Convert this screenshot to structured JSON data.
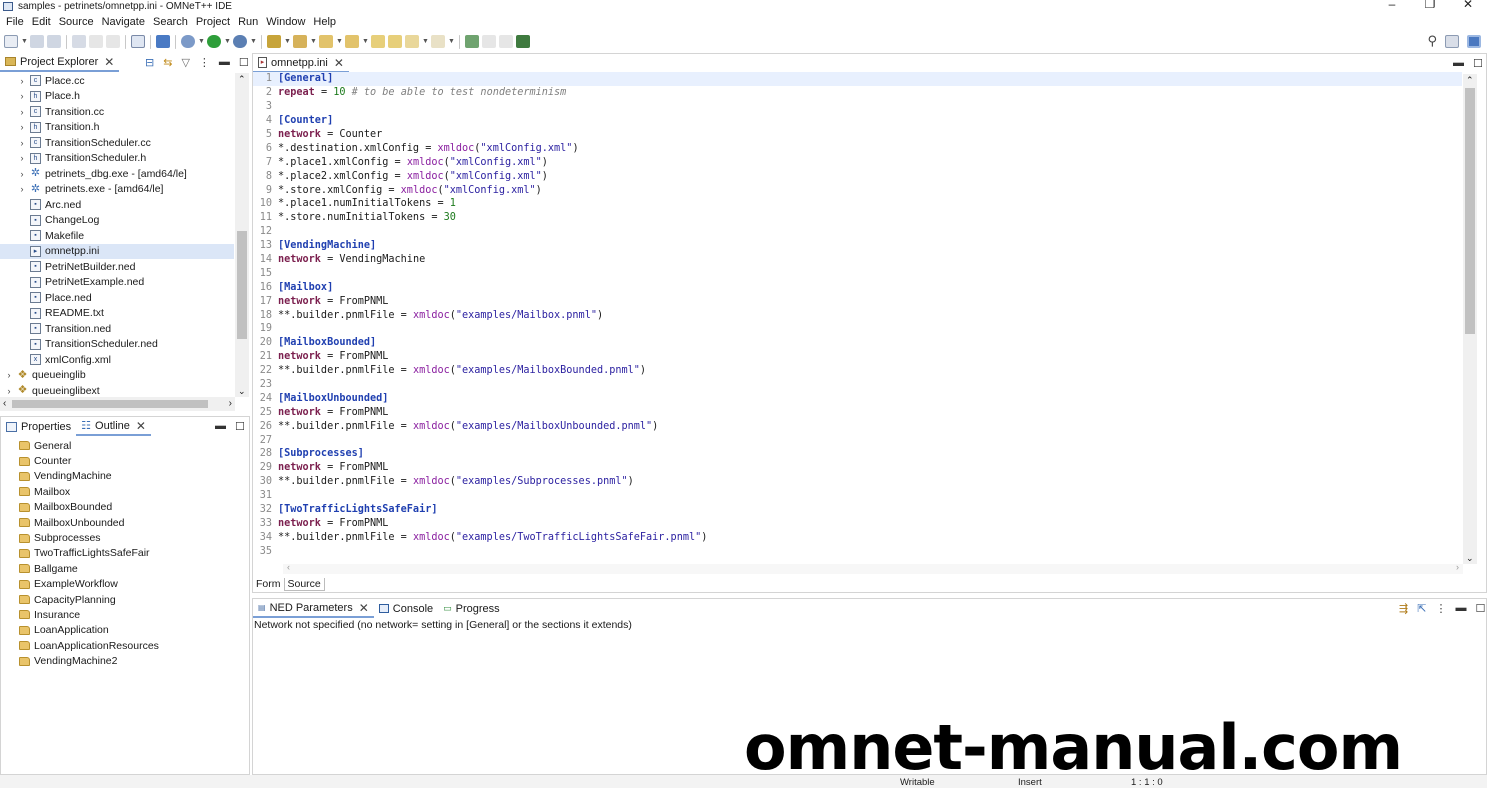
{
  "window": {
    "title": "samples - petrinets/omnetpp.ini - OMNeT++ IDE",
    "controls": [
      "–",
      "❐",
      "✕"
    ]
  },
  "menu": [
    "File",
    "Edit",
    "Source",
    "Navigate",
    "Search",
    "Project",
    "Run",
    "Window",
    "Help"
  ],
  "project_explorer": {
    "tab_label": "Project Explorer",
    "items": [
      {
        "label": "Place.cc",
        "icon": "c",
        "twisty": "›"
      },
      {
        "label": "Place.h",
        "icon": "h",
        "twisty": "›"
      },
      {
        "label": "Transition.cc",
        "icon": "c",
        "twisty": "›"
      },
      {
        "label": "Transition.h",
        "icon": "h",
        "twisty": "›"
      },
      {
        "label": "TransitionScheduler.cc",
        "icon": "c",
        "twisty": "›"
      },
      {
        "label": "TransitionScheduler.h",
        "icon": "h",
        "twisty": "›"
      },
      {
        "label": "petrinets_dbg.exe - [amd64/le]",
        "icon": "gear",
        "twisty": "›"
      },
      {
        "label": "petrinets.exe - [amd64/le]",
        "icon": "gear",
        "twisty": "›"
      },
      {
        "label": "Arc.ned",
        "icon": "ned",
        "twisty": ""
      },
      {
        "label": "ChangeLog",
        "icon": "txt",
        "twisty": ""
      },
      {
        "label": "Makefile",
        "icon": "mk",
        "twisty": ""
      },
      {
        "label": "omnetpp.ini",
        "icon": "ini",
        "twisty": "",
        "selected": true
      },
      {
        "label": "PetriNetBuilder.ned",
        "icon": "ned",
        "twisty": ""
      },
      {
        "label": "PetriNetExample.ned",
        "icon": "ned",
        "twisty": ""
      },
      {
        "label": "Place.ned",
        "icon": "ned",
        "twisty": ""
      },
      {
        "label": "README.txt",
        "icon": "txt",
        "twisty": ""
      },
      {
        "label": "Transition.ned",
        "icon": "ned",
        "twisty": ""
      },
      {
        "label": "TransitionScheduler.ned",
        "icon": "ned",
        "twisty": ""
      },
      {
        "label": "xmlConfig.xml",
        "icon": "x",
        "twisty": ""
      },
      {
        "label": "queueinglib",
        "icon": "proj",
        "twisty": "›",
        "root": true
      },
      {
        "label": "queueinglibext",
        "icon": "proj",
        "twisty": "›",
        "root": true
      }
    ]
  },
  "outline": {
    "tabs": [
      {
        "label": "Properties"
      },
      {
        "label": "Outline",
        "active": true
      }
    ],
    "items": [
      "General",
      "Counter",
      "VendingMachine",
      "Mailbox",
      "MailboxBounded",
      "MailboxUnbounded",
      "Subprocesses",
      "TwoTrafficLightsSafeFair",
      "Ballgame",
      "ExampleWorkflow",
      "CapacityPlanning",
      "Insurance",
      "LoanApplication",
      "LoanApplicationResources",
      "VendingMachine2"
    ]
  },
  "editor": {
    "tab_label": "omnetpp.ini",
    "bottom_tabs": [
      "Form",
      "Source"
    ],
    "lines": [
      [
        {
          "t": "[General]",
          "c": "section"
        }
      ],
      [
        {
          "t": "repeat",
          "c": "key"
        },
        {
          "t": " = ",
          "c": ""
        },
        {
          "t": "10",
          "c": "num"
        },
        {
          "t": " # to be able to test nondeterminism",
          "c": "comment"
        }
      ],
      [],
      [
        {
          "t": "[Counter]",
          "c": "section"
        }
      ],
      [
        {
          "t": "network",
          "c": "key"
        },
        {
          "t": " = Counter",
          "c": ""
        }
      ],
      [
        {
          "t": "*.destination.xmlConfig = ",
          "c": ""
        },
        {
          "t": "xmldoc",
          "c": "func"
        },
        {
          "t": "(",
          "c": ""
        },
        {
          "t": "\"xmlConfig.xml\"",
          "c": "str"
        },
        {
          "t": ")",
          "c": ""
        }
      ],
      [
        {
          "t": "*.place1.xmlConfig = ",
          "c": ""
        },
        {
          "t": "xmldoc",
          "c": "func"
        },
        {
          "t": "(",
          "c": ""
        },
        {
          "t": "\"xmlConfig.xml\"",
          "c": "str"
        },
        {
          "t": ")",
          "c": ""
        }
      ],
      [
        {
          "t": "*.place2.xmlConfig = ",
          "c": ""
        },
        {
          "t": "xmldoc",
          "c": "func"
        },
        {
          "t": "(",
          "c": ""
        },
        {
          "t": "\"xmlConfig.xml\"",
          "c": "str"
        },
        {
          "t": ")",
          "c": ""
        }
      ],
      [
        {
          "t": "*.store.xmlConfig = ",
          "c": ""
        },
        {
          "t": "xmldoc",
          "c": "func"
        },
        {
          "t": "(",
          "c": ""
        },
        {
          "t": "\"xmlConfig.xml\"",
          "c": "str"
        },
        {
          "t": ")",
          "c": ""
        }
      ],
      [
        {
          "t": "*.place1.numInitialTokens = ",
          "c": ""
        },
        {
          "t": "1",
          "c": "num"
        }
      ],
      [
        {
          "t": "*.store.numInitialTokens = ",
          "c": ""
        },
        {
          "t": "30",
          "c": "num"
        }
      ],
      [],
      [
        {
          "t": "[VendingMachine]",
          "c": "section"
        }
      ],
      [
        {
          "t": "network",
          "c": "key"
        },
        {
          "t": " = VendingMachine",
          "c": ""
        }
      ],
      [],
      [
        {
          "t": "[Mailbox]",
          "c": "section"
        }
      ],
      [
        {
          "t": "network",
          "c": "key"
        },
        {
          "t": " = FromPNML",
          "c": ""
        }
      ],
      [
        {
          "t": "**.builder.pnmlFile = ",
          "c": ""
        },
        {
          "t": "xmldoc",
          "c": "func"
        },
        {
          "t": "(",
          "c": ""
        },
        {
          "t": "\"examples/Mailbox.pnml\"",
          "c": "str"
        },
        {
          "t": ")",
          "c": ""
        }
      ],
      [],
      [
        {
          "t": "[MailboxBounded]",
          "c": "section"
        }
      ],
      [
        {
          "t": "network",
          "c": "key"
        },
        {
          "t": " = FromPNML",
          "c": ""
        }
      ],
      [
        {
          "t": "**.builder.pnmlFile = ",
          "c": ""
        },
        {
          "t": "xmldoc",
          "c": "func"
        },
        {
          "t": "(",
          "c": ""
        },
        {
          "t": "\"examples/MailboxBounded.pnml\"",
          "c": "str"
        },
        {
          "t": ")",
          "c": ""
        }
      ],
      [],
      [
        {
          "t": "[MailboxUnbounded]",
          "c": "section"
        }
      ],
      [
        {
          "t": "network",
          "c": "key"
        },
        {
          "t": " = FromPNML",
          "c": ""
        }
      ],
      [
        {
          "t": "**.builder.pnmlFile = ",
          "c": ""
        },
        {
          "t": "xmldoc",
          "c": "func"
        },
        {
          "t": "(",
          "c": ""
        },
        {
          "t": "\"examples/MailboxUnbounded.pnml\"",
          "c": "str"
        },
        {
          "t": ")",
          "c": ""
        }
      ],
      [],
      [
        {
          "t": "[Subprocesses]",
          "c": "section"
        }
      ],
      [
        {
          "t": "network",
          "c": "key"
        },
        {
          "t": " = FromPNML",
          "c": ""
        }
      ],
      [
        {
          "t": "**.builder.pnmlFile = ",
          "c": ""
        },
        {
          "t": "xmldoc",
          "c": "func"
        },
        {
          "t": "(",
          "c": ""
        },
        {
          "t": "\"examples/Subprocesses.pnml\"",
          "c": "str"
        },
        {
          "t": ")",
          "c": ""
        }
      ],
      [],
      [
        {
          "t": "[TwoTrafficLightsSafeFair]",
          "c": "section"
        }
      ],
      [
        {
          "t": "network",
          "c": "key"
        },
        {
          "t": " = FromPNML",
          "c": ""
        }
      ],
      [
        {
          "t": "**.builder.pnmlFile = ",
          "c": ""
        },
        {
          "t": "xmldoc",
          "c": "func"
        },
        {
          "t": "(",
          "c": ""
        },
        {
          "t": "\"examples/TwoTrafficLightsSafeFair.pnml\"",
          "c": "str"
        },
        {
          "t": ")",
          "c": ""
        }
      ],
      []
    ]
  },
  "bottom_panel": {
    "tabs": [
      {
        "label": "NED Parameters",
        "active": true,
        "closable": true
      },
      {
        "label": "Console"
      },
      {
        "label": "Progress"
      }
    ],
    "message": "Network not specified (no network= setting in [General] or the sections it extends)"
  },
  "status_bar": {
    "mode": "Writable",
    "insert": "Insert",
    "position": "1 : 1 : 0"
  },
  "watermark": "omnet-manual.com",
  "colors": {
    "section": "#1f3fb0",
    "key": "#7b1f4e",
    "number": "#1c7a1c",
    "function": "#8a1fa0",
    "string": "#2a1fa0",
    "comment": "#7f7f7f",
    "selection": "#dbe6f7"
  }
}
